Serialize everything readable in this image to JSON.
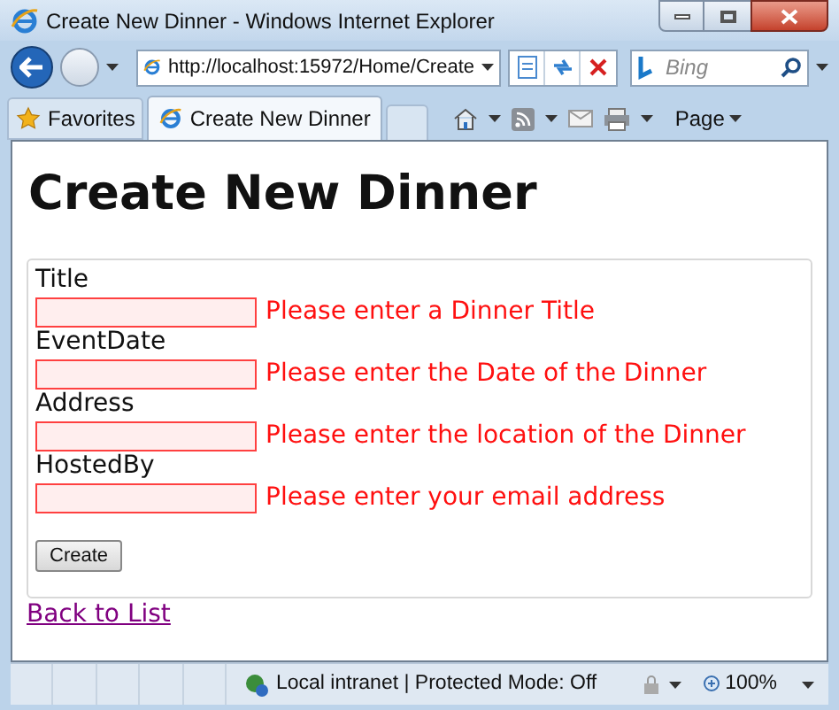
{
  "window": {
    "title": "Create New Dinner - Windows Internet Explorer"
  },
  "address_bar": {
    "value": "http://localhost:15972/Home/Create"
  },
  "search": {
    "placeholder": "Bing"
  },
  "favorites": {
    "label": "Favorites"
  },
  "tabs": [
    {
      "label": "Create New Dinner",
      "selected": true
    }
  ],
  "command_bar": {
    "page_menu": "Page"
  },
  "page": {
    "heading": "Create New Dinner",
    "fields": [
      {
        "label": "Title",
        "error": "Please enter a Dinner Title"
      },
      {
        "label": "EventDate",
        "error": "Please enter the Date of the Dinner"
      },
      {
        "label": "Address",
        "error": "Please enter the location of the Dinner"
      },
      {
        "label": "HostedBy",
        "error": "Please enter your email address"
      }
    ],
    "submit": "Create",
    "link": "Back to List"
  },
  "status_bar": {
    "zone": "Local intranet | Protected Mode: Off",
    "zoom": "100%"
  }
}
